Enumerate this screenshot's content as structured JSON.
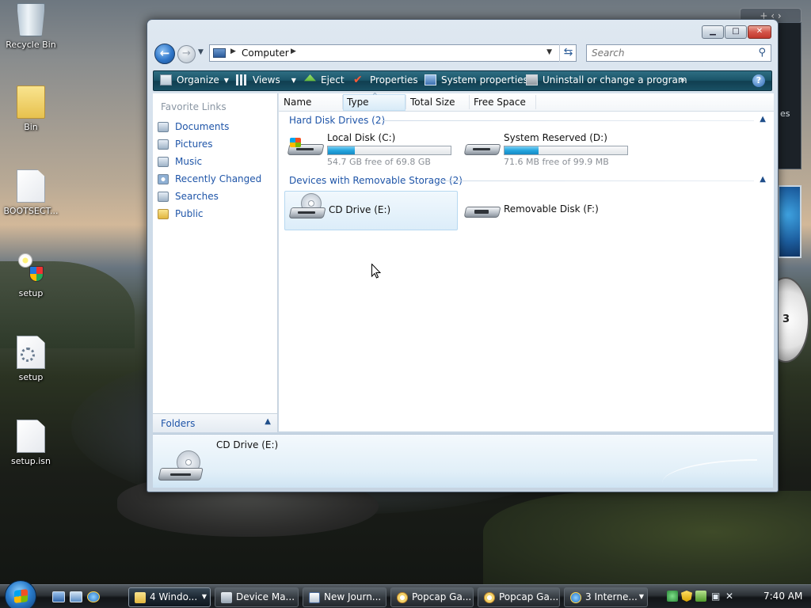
{
  "desktop": {
    "icons": [
      {
        "label": "Recycle Bin",
        "icon": "recycle-bin-icon"
      },
      {
        "label": "Bin",
        "icon": "folder-icon"
      },
      {
        "label": "BOOTSECT...",
        "icon": "file-icon"
      },
      {
        "label": "setup",
        "icon": "setup-icon"
      },
      {
        "label": "setup",
        "icon": "setup-config-icon"
      },
      {
        "label": "setup.isn",
        "icon": "file-icon"
      }
    ],
    "side_panel_text": "es",
    "side_clock_digit": "3"
  },
  "window": {
    "caption_buttons": {
      "minimize": "▁",
      "maximize": "□",
      "close": "✕"
    },
    "address": {
      "crumb": "Computer"
    },
    "search": {
      "placeholder": "Search"
    },
    "commands": [
      {
        "label": "Organize",
        "has_dropdown": true,
        "icon": "organize-icon"
      },
      {
        "label": "Views",
        "has_dropdown": true,
        "icon": "views-icon"
      },
      {
        "label": "Eject",
        "has_dropdown": false,
        "icon": "eject-icon"
      },
      {
        "label": "Properties",
        "has_dropdown": false,
        "icon": "properties-icon"
      },
      {
        "label": "System properties",
        "has_dropdown": false,
        "icon": "system-properties-icon"
      },
      {
        "label": "Uninstall or change a program",
        "has_dropdown": false,
        "icon": "uninstall-icon"
      }
    ],
    "commands_overflow": "»",
    "help_label": "?",
    "nav_pane": {
      "header": "Favorite Links",
      "links": [
        "Documents",
        "Pictures",
        "Music",
        "Recently Changed",
        "Searches",
        "Public"
      ],
      "folders_label": "Folders"
    },
    "columns": [
      "Name",
      "Type",
      "Total Size",
      "Free Space"
    ],
    "groups": [
      {
        "title": "Hard Disk Drives (2)",
        "items": [
          {
            "name": "Local Disk (C:)",
            "detail": "54.7 GB free of 69.8 GB",
            "used_fraction": 0.22
          },
          {
            "name": "System Reserved (D:)",
            "detail": "71.6 MB free of 99.9 MB",
            "used_fraction": 0.28
          }
        ]
      },
      {
        "title": "Devices with Removable Storage (2)",
        "items": [
          {
            "name": "CD Drive (E:)",
            "selected": true
          },
          {
            "name": "Removable Disk (F:)"
          }
        ]
      }
    ],
    "details_pane": {
      "name": "CD Drive (E:)"
    }
  },
  "taskbar": {
    "buttons": [
      {
        "label": "4 Windo...",
        "has_dropdown": true,
        "active": true
      },
      {
        "label": "Device Ma..."
      },
      {
        "label": "New Journ..."
      },
      {
        "label": "Popcap Ga..."
      },
      {
        "label": "Popcap Ga..."
      },
      {
        "label": "3 Interne...",
        "has_dropdown": true
      }
    ],
    "clock": "7:40 AM"
  },
  "colors": {
    "link_blue": "#1f55a8",
    "command_bar": "#1a5468",
    "progress_fill": "#26a6df",
    "selection": "#dcedf9"
  }
}
